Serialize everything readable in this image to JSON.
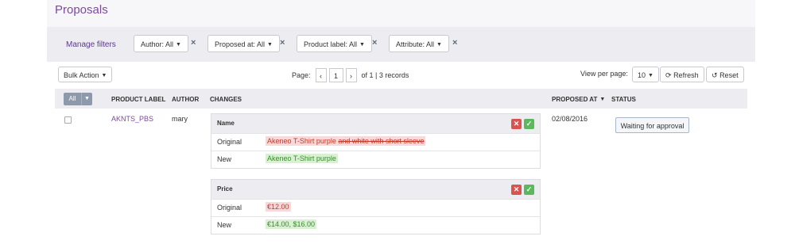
{
  "header": {
    "title": "Proposals"
  },
  "filters": {
    "manage_label": "Manage filters",
    "author": "Author: All",
    "proposed_at": "Proposed at: All",
    "product_label": "Product label: All",
    "attribute": "Attribute: All",
    "remove_icon": "×"
  },
  "toolbar": {
    "bulk_action": "Bulk Action",
    "page_label": "Page:",
    "page_value": "1",
    "of_label": "of 1 | 3 records",
    "view_per_page_label": "View per page:",
    "view_per_page_value": "10",
    "refresh_label": "Refresh",
    "reset_label": "Reset"
  },
  "columns": {
    "all": "All",
    "product_label": "PRODUCT LABEL",
    "author": "AUTHOR",
    "changes": "CHANGES",
    "proposed_at": "PROPOSED AT",
    "status": "STATUS"
  },
  "rows": [
    {
      "product_label": "AKNTS_PBS",
      "author": "mary",
      "proposed_at": "02/08/2016",
      "status": "Waiting for approval",
      "changes": [
        {
          "attribute": "Name",
          "original_label": "Original",
          "original_value": "Akeneo T-Shirt purple",
          "original_removed": "and white with short sleeve",
          "new_label": "New",
          "new_value": "Akeneo T-Shirt purple"
        },
        {
          "attribute": "Price",
          "original_label": "Original",
          "original_value": "€12.00",
          "new_label": "New",
          "new_value": "€14.00, $16.00"
        }
      ]
    }
  ],
  "icons": {
    "reject": "✕",
    "accept": "✓",
    "caret": "▼",
    "prev": "‹",
    "next": "›",
    "refresh": "⟳",
    "reset": "↺"
  },
  "colors": {
    "accent": "#7b4a9c",
    "reject": "#d9534f",
    "accept": "#5cb85c"
  }
}
